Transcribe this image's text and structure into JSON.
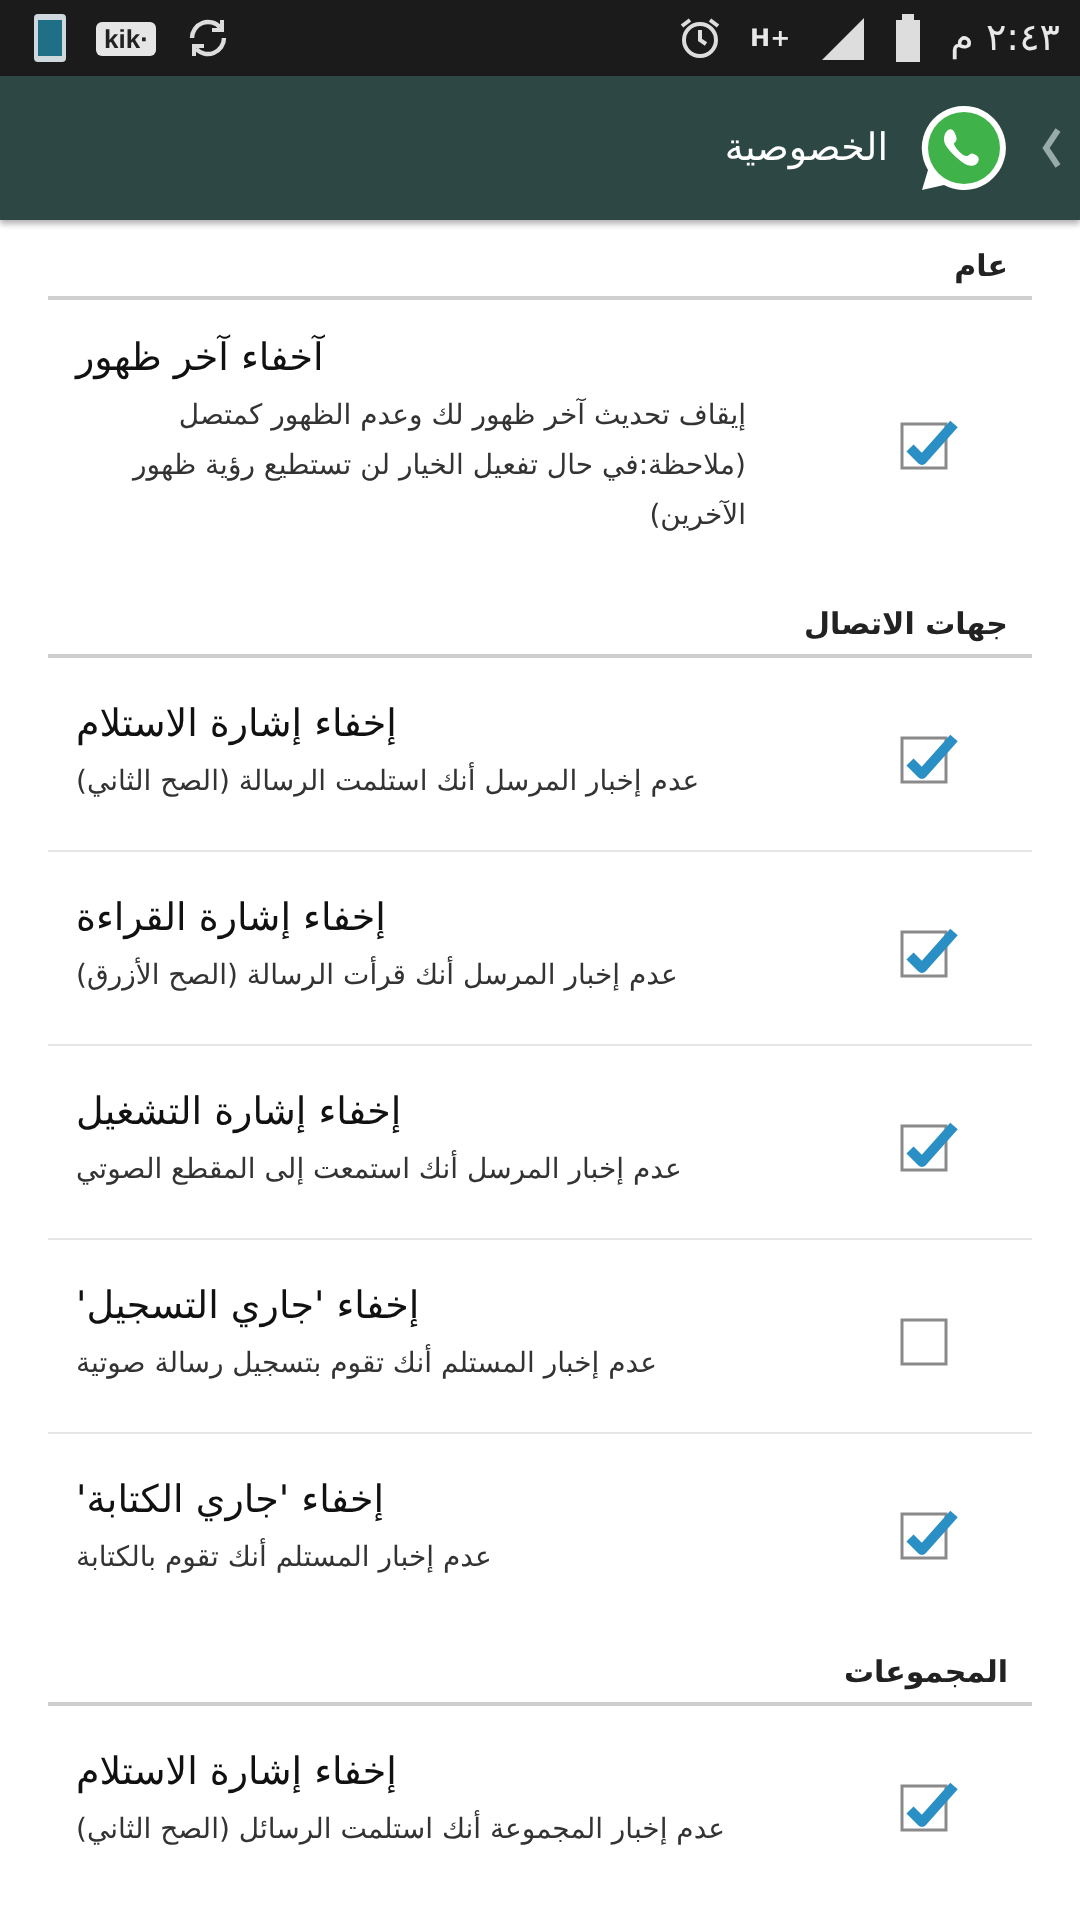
{
  "status_bar": {
    "app_label": "kik·",
    "network": "H+",
    "time": "٢:٤٣ م"
  },
  "header": {
    "title": "الخصوصية"
  },
  "sections": [
    {
      "title": "عام",
      "items": [
        {
          "title": "آخفاء آخر ظهور",
          "summary": "إيقاف تحديث آخر ظهور لك وعدم الظهور كمتصل (ملاحظة:في حال تفعيل الخيار لن تستطيع رؤية ظهور الآخرين)",
          "checked": true
        }
      ]
    },
    {
      "title": "جهات الاتصال",
      "items": [
        {
          "title": "إخفاء إشارة الاستلام",
          "summary": "عدم إخبار المرسل أنك استلمت الرسالة (الصح الثاني)",
          "checked": true
        },
        {
          "title": "إخفاء إشارة القراءة",
          "summary": "عدم إخبار المرسل أنك قرأت الرسالة (الصح الأزرق)",
          "checked": true
        },
        {
          "title": "إخفاء إشارة التشغيل",
          "summary": "عدم إخبار المرسل أنك استمعت إلى المقطع الصوتي",
          "checked": true
        },
        {
          "title": "إخفاء 'جاري التسجيل'",
          "summary": "عدم إخبار المستلم أنك تقوم بتسجيل رسالة صوتية",
          "checked": false
        },
        {
          "title": "إخفاء 'جاري الكتابة'",
          "summary": "عدم إخبار المستلم أنك تقوم بالكتابة",
          "checked": true
        }
      ]
    },
    {
      "title": "المجموعات",
      "items": [
        {
          "title": "إخفاء إشارة الاستلام",
          "summary": "عدم إخبار المجموعة أنك استلمت الرسائل (الصح الثاني)",
          "checked": true
        }
      ]
    }
  ]
}
